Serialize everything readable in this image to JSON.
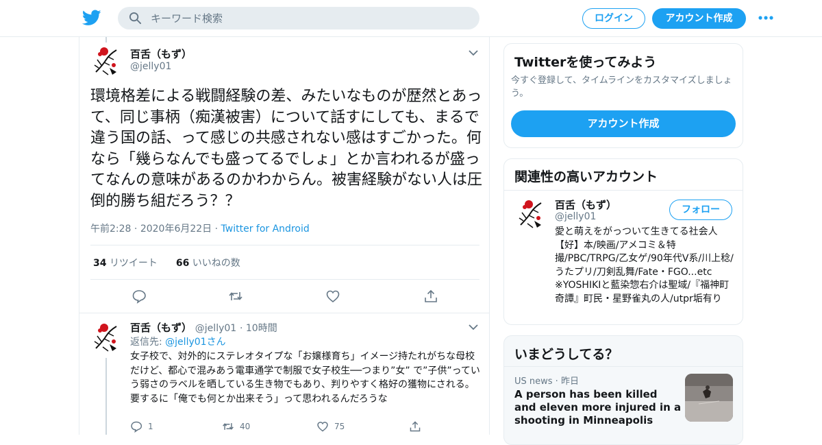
{
  "header": {
    "logo": "twitter-bird-icon",
    "search_placeholder": "キーワード検索",
    "login_label": "ログイン",
    "signup_label": "アカウント作成",
    "more_icon": "more-dots-icon",
    "brand_color": "#1da1f2"
  },
  "main_tweet": {
    "name": "百舌（もず）",
    "handle": "@jelly01",
    "text": "環境格差による戦闘経験の差、みたいなものが歴然とあって、同じ事柄（痴漢被害）について話すにしても、まるで違う国の話、って感じの共感されない感はすごかった。何なら「幾らなんでも盛ってるでしょ」とか言われるが盛ってなんの意味があるのかわからん。被害経験がない人は圧倒的勝ち組だろう？？",
    "time": "午前2:28",
    "date": "2020年6月22日",
    "source": "Twitter for Android",
    "retweet_count": "34",
    "retweet_label": "リツイート",
    "like_count": "66",
    "like_label": "いいねの数",
    "actions": [
      "reply-icon",
      "retweet-icon",
      "like-icon",
      "share-icon"
    ]
  },
  "reply_tweet": {
    "name": "百舌（もず）",
    "handle": "@jelly01",
    "time": "10時間",
    "reply_to_prefix": "返信先: ",
    "reply_to_handle": "@jelly01",
    "reply_to_suffix": "さん",
    "text": "女子校で、対外的にステレオタイプな「お嬢様育ち」イメージ持たれがちな母校だけど、都心で混みあう電車通学で制服で女子校生──つまり”女” で”子供”っていう弱さのラベルを晒している生き物でもあり、判りやすく格好の獲物にされる。要するに「俺でも何とか出来そう」って思われるんだろうな",
    "reply_count": "1",
    "retweet_count": "40",
    "like_count": "75"
  },
  "sidebar": {
    "signup_card": {
      "title": "Twitterを使ってみよう",
      "subtitle": "今すぐ登録して、タイムラインをカスタマイズしましょう。",
      "button": "アカウント作成"
    },
    "related_card": {
      "title": "関連性の高いアカウント",
      "name": "百舌（もず）",
      "handle": "@jelly01",
      "follow_label": "フォロー",
      "bio": "愛と萌えをがっついて生きてる社会人　【好】本/映画/アメコミ＆特撮/PBC/TRPG/乙女ゲ/90年代V系/川上稔/うたプリ/刀剣乱舞/Fate・FGO...etc　※YOSHIKIと藍染惣右介は聖域/『福神町奇譚』町民・星野雀丸の人/utpr垢有り"
    },
    "trend_card": {
      "title": "いまどうしてる？",
      "category": "US news",
      "time": "昨日",
      "headline": "A person has been killed and eleven more injured in a shooting in Minneapolis"
    }
  }
}
